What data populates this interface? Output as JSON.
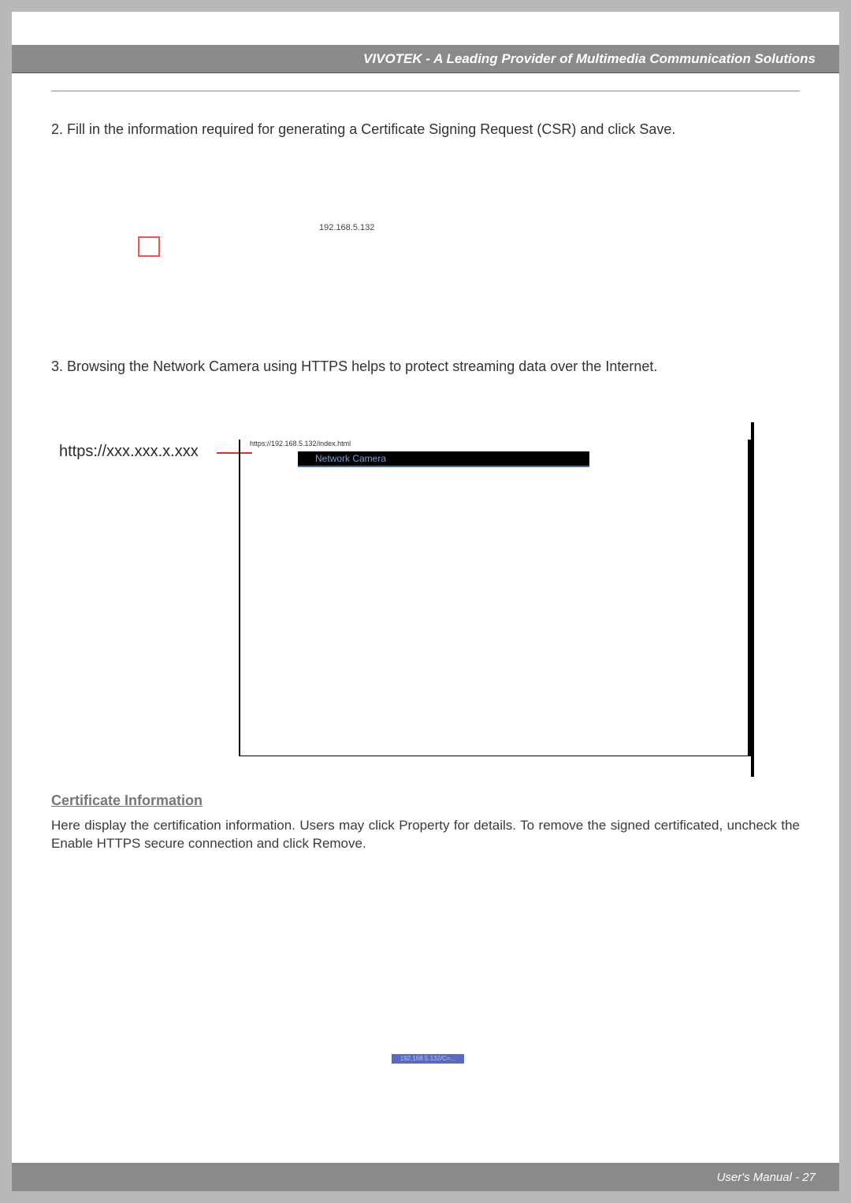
{
  "header": {
    "title": "VIVOTEK - A Leading Provider of Multimedia Communication Solutions"
  },
  "steps": {
    "s2": "2. Fill in the information required for generating a Certificate Signing Request (CSR) and click Save.",
    "s3": "3. Browsing the Network Camera using HTTPS helps to protect streaming data over the Internet."
  },
  "fig1": {
    "ip": "192.168.5.132"
  },
  "fig2": {
    "https_label": "https://xxx.xxx.x.xxx",
    "url": "https://192.168.5.132/index.html",
    "banner_text": "Network Camera"
  },
  "section": {
    "heading": "Certificate Information",
    "body": "Here display the certification information. Users may click Property for details. To remove the signed certificated, uncheck the Enable HTTPS secure connection and click Remove.",
    "strip": "192.168.5.132/C=..."
  },
  "footer": {
    "text": "User's Manual - 27"
  }
}
